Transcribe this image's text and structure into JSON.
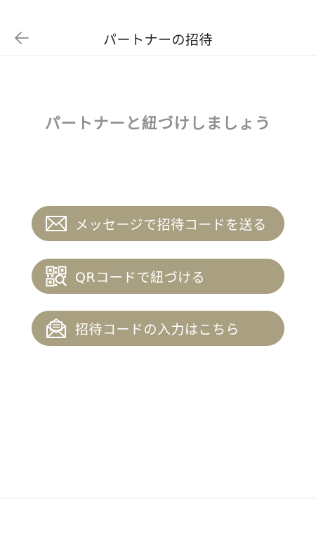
{
  "header": {
    "title": "パートナーの招待",
    "back_icon": "arrow-left-icon"
  },
  "main": {
    "headline": "パートナーと紐づけしましょう",
    "buttons": [
      {
        "label": "メッセージで招待コードを送る",
        "icon": "envelope-icon"
      },
      {
        "label": "QRコードで紐づける",
        "icon": "qr-code-icon"
      },
      {
        "label": "招待コードの入力はこちら",
        "icon": "open-envelope-icon"
      }
    ]
  },
  "colors": {
    "button_bg": "#a8a081",
    "headline_text": "#8f8f8f",
    "divider": "#e6e6e6"
  }
}
